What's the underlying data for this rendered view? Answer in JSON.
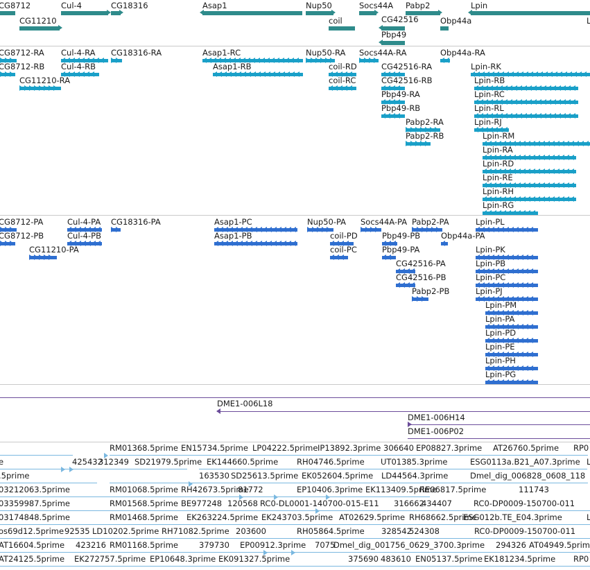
{
  "colors": {
    "gene": "#2e8b8b",
    "transcript": "#1aa0c8",
    "cds": "#2f6fd0",
    "clone": "#6b4c9a",
    "est": "#7ab8e0",
    "divider": "#c9c9c9"
  },
  "tracks": {
    "genes": {
      "labels": [
        "CG8712",
        "CG11210",
        "Cul-4",
        "CG18316",
        "Asap1",
        "Nup50",
        "coil",
        "Socs44A",
        "CG42516",
        "Pbp49",
        "Pabp2",
        "Obp44a",
        "Lpin"
      ]
    },
    "transcripts": {
      "labels": [
        "CG8712-RA",
        "CG8712-RB",
        "CG11210-RA",
        "Cul-4-RA",
        "Cul-4-RB",
        "CG18316-RA",
        "Asap1-RC",
        "Asap1-RB",
        "Nup50-RA",
        "coil-RD",
        "coil-RC",
        "Socs44A-RA",
        "CG42516-RA",
        "CG42516-RB",
        "Pbp49-RA",
        "Pbp49-RB",
        "Pabp2-RA",
        "Pabp2-RB",
        "Obp44a-RA",
        "Lpin-RK",
        "Lpin-RB",
        "Lpin-RC",
        "Lpin-RL",
        "Lpin-RJ",
        "Lpin-RM",
        "Lpin-RA",
        "Lpin-RD",
        "Lpin-RE",
        "Lpin-RH",
        "Lpin-RG"
      ]
    },
    "proteins": {
      "labels": [
        "CG8712-PA",
        "CG8712-PB",
        "CG11210-PA",
        "Cul-4-PA",
        "Cul-4-PB",
        "CG18316-PA",
        "Asap1-PC",
        "Asap1-PB",
        "Nup50-PA",
        "coil-PD",
        "coil-PC",
        "Socs44A-PA",
        "Pabp2-PA",
        "Pbp49-PB",
        "Pbp49-PA",
        "CG42516-PA",
        "CG42516-PB",
        "Pabp2-PB",
        "Obp44a-PA",
        "Lpin-PL",
        "Lpin-PK",
        "Lpin-PB",
        "Lpin-PC",
        "Lpin-PJ",
        "Lpin-PM",
        "Lpin-PA",
        "Lpin-PD",
        "Lpin-PE",
        "Lpin-PH",
        "Lpin-PG"
      ]
    },
    "clones": {
      "labels": [
        "DME1-006L18",
        "DME1-006H14",
        "DME1-006P02"
      ]
    },
    "ests": {
      "row1": [
        "RM01368.5prime",
        "EN15734.5prime",
        "LP04222.5prime",
        "IP13892.3prime",
        "306640",
        "EP08827.3prime",
        "AT26760.5prime",
        "RP0"
      ],
      "row2": [
        "e",
        "425432",
        "312349",
        "SD21979.5prime",
        "EK144660.5prime",
        "RH04746.5prime",
        "UT01385.3prime",
        "ESG0113a.B21_A07.3prime",
        "L"
      ],
      "row3": [
        ".5prime",
        "163530",
        "SD25613.5prime",
        "EK052604.5prime",
        "LD44564.3prime",
        "Dmel_dig_006828_0608_118"
      ],
      "row4": [
        "03212063.5prime",
        "RM01068.5prime",
        "RH42673.5prime",
        "81772",
        "EP10406.3prime",
        "EK113409.5prime",
        "RE06817.5prime",
        "111743"
      ],
      "row5": [
        "03359987.5prime",
        "RM01568.5prime",
        "BE977248",
        "120568",
        "RC0-DL0001-140700-015-E11",
        "316662",
        "434407",
        "RC0-DP0009-150700-011"
      ],
      "row6": [
        "03174848.5prime",
        "RM01468.5prime",
        "EK263224.5prime",
        "EK243703.5prime",
        "AT02629.5prime",
        "RH68662.5prime",
        "ESG012b.TE_E04.3prime",
        "L"
      ],
      "row7": [
        "os69d12.5prime",
        "92535",
        "LD10202.5prime",
        "RH71082.5prime",
        "203600",
        "RH05864.5prime",
        "328542",
        "524308",
        "RC0-DP0009-150700-011"
      ],
      "row8": [
        "AT16604.5prime",
        "423216",
        "RM01168.5prime",
        "379730",
        "EP00912.3prime",
        "7075",
        "Dmel_dig_001756_0629_3700.3prime",
        "294326",
        "AT04949.5prime"
      ],
      "row9": [
        "AT24125.5prime",
        "EK272757.5prime",
        "EP10648.3prime",
        "EK091327.5prime",
        "375690",
        "483610",
        "EN05137.5prime",
        "EK181234.5prime",
        "RP0"
      ]
    }
  }
}
